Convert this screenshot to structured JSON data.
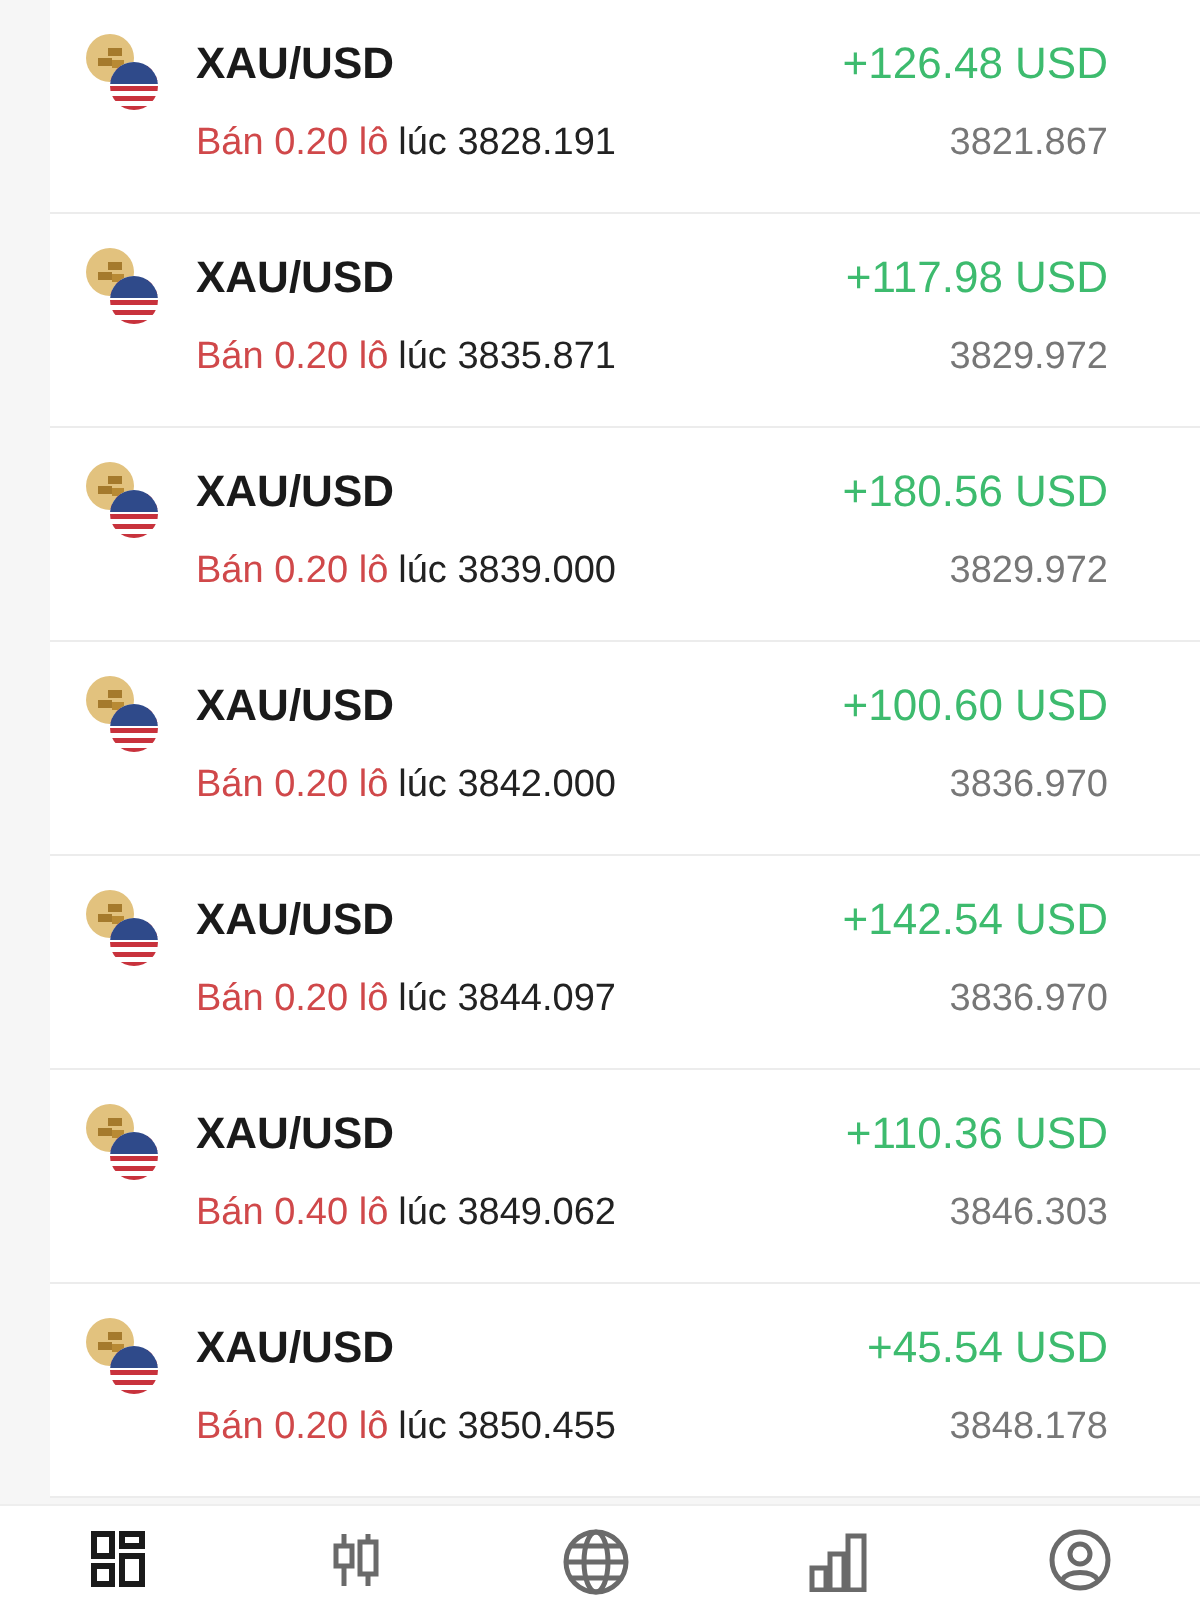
{
  "positions": [
    {
      "symbol": "XAU/USD",
      "order": "Bán 0.20 lô",
      "entry": "lúc 3828.191",
      "profit": "+126.48 USD",
      "price": "3821.867"
    },
    {
      "symbol": "XAU/USD",
      "order": "Bán 0.20 lô",
      "entry": "lúc 3835.871",
      "profit": "+117.98 USD",
      "price": "3829.972"
    },
    {
      "symbol": "XAU/USD",
      "order": "Bán 0.20 lô",
      "entry": "lúc 3839.000",
      "profit": "+180.56 USD",
      "price": "3829.972"
    },
    {
      "symbol": "XAU/USD",
      "order": "Bán 0.20 lô",
      "entry": "lúc 3842.000",
      "profit": "+100.60 USD",
      "price": "3836.970"
    },
    {
      "symbol": "XAU/USD",
      "order": "Bán 0.20 lô",
      "entry": "lúc 3844.097",
      "profit": "+142.54 USD",
      "price": "3836.970"
    },
    {
      "symbol": "XAU/USD",
      "order": "Bán 0.40 lô",
      "entry": "lúc 3849.062",
      "profit": "+110.36 USD",
      "price": "3846.303"
    },
    {
      "symbol": "XAU/USD",
      "order": "Bán 0.20 lô",
      "entry": "lúc 3850.455",
      "profit": "+45.54 USD",
      "price": "3848.178"
    }
  ],
  "bottom_nav": [
    {
      "kind": "grid",
      "selected": true
    },
    {
      "kind": "candles",
      "selected": false
    },
    {
      "kind": "globe",
      "selected": false
    },
    {
      "kind": "bars",
      "selected": false
    },
    {
      "kind": "profile",
      "selected": false
    }
  ]
}
